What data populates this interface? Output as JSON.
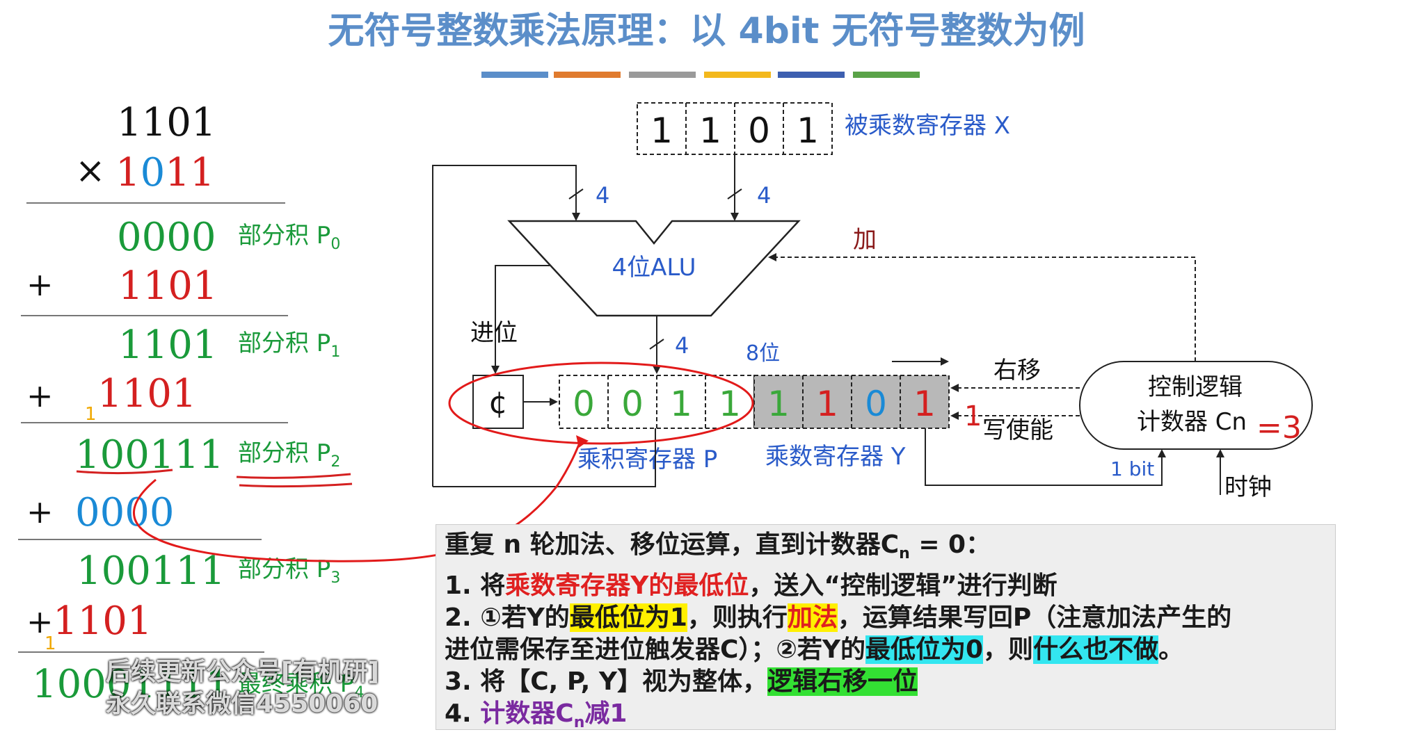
{
  "title": "无符号整数乘法原理：以 4bit 无符号整数为例",
  "colors": {
    "title": "#5b8ec9",
    "bar": [
      "#5b8ec9",
      "#e07b2e",
      "#9a9a9a",
      "#f3b81c",
      "#3d5fb0",
      "#5aa348"
    ],
    "green": "#1a9a3a",
    "red": "#d42020",
    "blue": "#1a8ad6"
  },
  "calc": {
    "multiplicand": "1101",
    "times": "×",
    "multiplier_0": "1",
    "multiplier_1": "0",
    "multiplier_2": "11",
    "rows": [
      {
        "value": "0000",
        "color": "green",
        "label": "部分积 P",
        "sub": "0"
      },
      {
        "value": "1101",
        "color": "red",
        "plus": "+"
      },
      {
        "value": "1101",
        "color": "green",
        "label": "部分积 P",
        "sub": "1"
      },
      {
        "value": "1101",
        "color": "red",
        "plus": "+",
        "carry": "1"
      },
      {
        "value": "100111",
        "color": "green",
        "label": "部分积 P",
        "sub": "2"
      },
      {
        "value": "0000",
        "color": "blue",
        "plus": "+"
      },
      {
        "value": "100111",
        "color": "green",
        "label": "部分积 P",
        "sub": "3"
      },
      {
        "value": "1101",
        "color": "red",
        "plus": "+",
        "carry": "1"
      },
      {
        "value": "10001111",
        "color": "green",
        "label": "最终乘积 P",
        "sub": "4"
      }
    ]
  },
  "diagram": {
    "x_bits": [
      "1",
      "1",
      "0",
      "1"
    ],
    "x_label": "被乘数寄存器 X",
    "bus_width_left": "4",
    "bus_width_right": "4",
    "bus_width_out": "4",
    "alu_label": "4位ALU",
    "carry_label": "进位",
    "c_bit": "¢",
    "p_bits": [
      "0",
      "0",
      "1",
      "1"
    ],
    "y_bits": [
      "1",
      "1",
      "0",
      "1"
    ],
    "eight_bit_label": "8位",
    "p_label": "乘积寄存器 P",
    "y_label": "乘数寄存器 Y",
    "shift_label": "右移",
    "write_enable_label": "写使能",
    "add_label": "加",
    "control_line1": "控制逻辑",
    "control_line2": "计数器 Cn",
    "control_value": "=3",
    "one_bit_label": "1 bit",
    "clock_label": "时钟",
    "side_mark": "1"
  },
  "info": {
    "line0_a": "重复 n 轮加法、移位运算，直到计数器C",
    "line0_sub": "n",
    "line0_b": " = 0：",
    "line1_a": "1. 将",
    "line1_red": "乘数寄存器Y的最低位",
    "line1_b": "，送入“控制逻辑”进行判断",
    "line2_a": "2. ①若Y的",
    "line2_hl1": "最低位为1",
    "line2_b": "，则执行",
    "line2_hl2": "加法",
    "line2_c": "，运算结果写回P（注意加法产生的",
    "line3_a": "进位需保存至进位触发器C）；②若Y的",
    "line3_hl1": "最低位为0",
    "line3_b": "，则",
    "line3_hl2": "什么也不做",
    "line3_c": "。",
    "line4_a": "3. 将【C, P, Y】视为整体，",
    "line4_hl": "逻辑右移一位",
    "line5_a": "4. ",
    "line5_purple": "计数器C",
    "line5_sub": "n",
    "line5_b": "减1"
  },
  "watermark": {
    "line1": "后续更新公众号[有机研]",
    "line2": "永久联系微信4550060"
  }
}
